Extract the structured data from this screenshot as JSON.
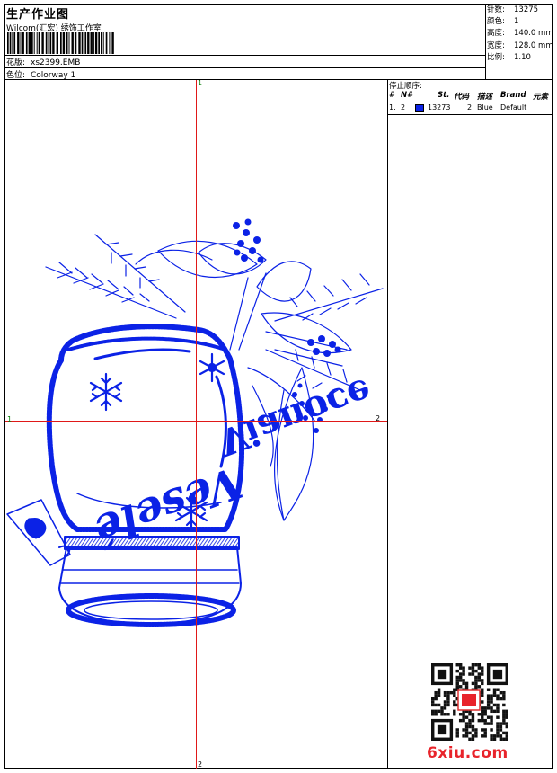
{
  "header": {
    "title": "生产作业图",
    "company": "Wilcom(汇宏) 绣饰工作室",
    "design_label": "花版:",
    "design_value": "xs2399.EMB",
    "colorway_label": "色位:",
    "colorway_value": "Colorway 1"
  },
  "stats": [
    {
      "label": "针数:",
      "value": "13275"
    },
    {
      "label": "颜色:",
      "value": "1"
    },
    {
      "label": "高度:",
      "value": "140.0 mm"
    },
    {
      "label": "宽度:",
      "value": "128.0 mm"
    },
    {
      "label": "比例:",
      "value": "1.10"
    }
  ],
  "sequence": {
    "title": "停止顺序:",
    "headers": [
      "#",
      "N#",
      "St.",
      "代码",
      "描述",
      "Brand",
      "元素"
    ],
    "rows": [
      {
        "num": "1.",
        "needle": "2",
        "stitches": "13273",
        "code": "2",
        "description": "Blue",
        "brand": "Default",
        "color": "#0b22e6"
      }
    ]
  },
  "crosshair": {
    "left": "1",
    "right": "2",
    "top": "1",
    "bottom": "2"
  },
  "design_text": {
    "word1": "Vianoce",
    "word2": "Veselé"
  },
  "watermark": {
    "logo": "6xiu.com"
  },
  "colors": {
    "thread": "#0b22e6",
    "crosshair": "#e01818"
  }
}
